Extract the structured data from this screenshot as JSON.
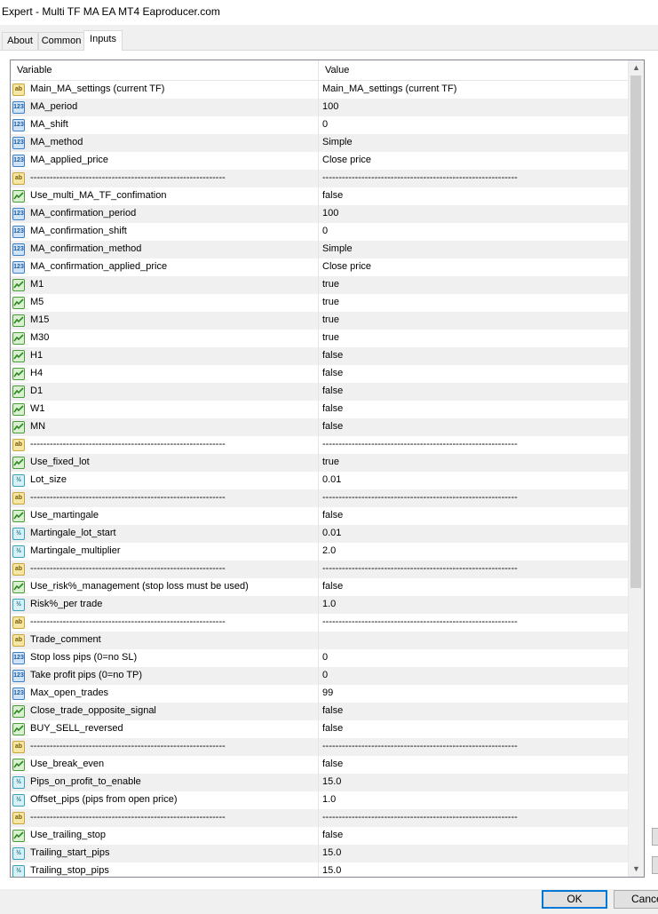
{
  "window": {
    "title": "Expert - Multi TF MA EA MT4 Eaproducer.com"
  },
  "tabs": [
    {
      "label": "About"
    },
    {
      "label": "Common"
    },
    {
      "label": "Inputs"
    }
  ],
  "grid": {
    "col_variable": "Variable",
    "col_value": "Value",
    "rows": [
      {
        "icon": "ab",
        "name": "Main_MA_settings (current TF)",
        "value": "Main_MA_settings (current TF)"
      },
      {
        "icon": "123",
        "name": "MA_period",
        "value": "100"
      },
      {
        "icon": "123",
        "name": "MA_shift",
        "value": "0"
      },
      {
        "icon": "123",
        "name": "MA_method",
        "value": "Simple"
      },
      {
        "icon": "123",
        "name": "MA_applied_price",
        "value": "Close price"
      },
      {
        "icon": "ab",
        "name": "------------------------------------------------------------",
        "value": "------------------------------------------------------------"
      },
      {
        "icon": "bool",
        "name": "Use_multi_MA_TF_confimation",
        "value": "false"
      },
      {
        "icon": "123",
        "name": "MA_confirmation_period",
        "value": "100"
      },
      {
        "icon": "123",
        "name": "MA_confirmation_shift",
        "value": "0"
      },
      {
        "icon": "123",
        "name": "MA_confirmation_method",
        "value": "Simple"
      },
      {
        "icon": "123",
        "name": "MA_confirmation_applied_price",
        "value": "Close price"
      },
      {
        "icon": "bool",
        "name": "M1",
        "value": "true"
      },
      {
        "icon": "bool",
        "name": "M5",
        "value": "true"
      },
      {
        "icon": "bool",
        "name": "M15",
        "value": "true"
      },
      {
        "icon": "bool",
        "name": "M30",
        "value": "true"
      },
      {
        "icon": "bool",
        "name": "H1",
        "value": "false"
      },
      {
        "icon": "bool",
        "name": "H4",
        "value": "false"
      },
      {
        "icon": "bool",
        "name": "D1",
        "value": "false"
      },
      {
        "icon": "bool",
        "name": "W1",
        "value": "false"
      },
      {
        "icon": "bool",
        "name": "MN",
        "value": "false"
      },
      {
        "icon": "ab",
        "name": "------------------------------------------------------------",
        "value": "------------------------------------------------------------"
      },
      {
        "icon": "bool",
        "name": "Use_fixed_lot",
        "value": "true"
      },
      {
        "icon": "dbl",
        "name": "Lot_size",
        "value": "0.01"
      },
      {
        "icon": "ab",
        "name": "------------------------------------------------------------",
        "value": "------------------------------------------------------------"
      },
      {
        "icon": "bool",
        "name": "Use_martingale",
        "value": "false"
      },
      {
        "icon": "dbl",
        "name": "Martingale_lot_start",
        "value": "0.01"
      },
      {
        "icon": "dbl",
        "name": "Martingale_multiplier",
        "value": "2.0"
      },
      {
        "icon": "ab",
        "name": "------------------------------------------------------------",
        "value": "------------------------------------------------------------"
      },
      {
        "icon": "bool",
        "name": "Use_risk%_management (stop loss must be used)",
        "value": "false"
      },
      {
        "icon": "dbl",
        "name": "Risk%_per trade",
        "value": "1.0"
      },
      {
        "icon": "ab",
        "name": "------------------------------------------------------------",
        "value": "------------------------------------------------------------"
      },
      {
        "icon": "ab",
        "name": "Trade_comment",
        "value": ""
      },
      {
        "icon": "123",
        "name": "Stop loss pips (0=no SL)",
        "value": "0"
      },
      {
        "icon": "123",
        "name": "Take profit pips (0=no TP)",
        "value": "0"
      },
      {
        "icon": "123",
        "name": "Max_open_trades",
        "value": "99"
      },
      {
        "icon": "bool",
        "name": "Close_trade_opposite_signal",
        "value": "false"
      },
      {
        "icon": "bool",
        "name": "BUY_SELL_reversed",
        "value": "false"
      },
      {
        "icon": "ab",
        "name": "------------------------------------------------------------",
        "value": "------------------------------------------------------------"
      },
      {
        "icon": "bool",
        "name": "Use_break_even",
        "value": "false"
      },
      {
        "icon": "dbl",
        "name": "Pips_on_profit_to_enable",
        "value": "15.0"
      },
      {
        "icon": "dbl",
        "name": "Offset_pips (pips from open price)",
        "value": "1.0"
      },
      {
        "icon": "ab",
        "name": "------------------------------------------------------------",
        "value": "------------------------------------------------------------"
      },
      {
        "icon": "bool",
        "name": "Use_trailing_stop",
        "value": "false"
      },
      {
        "icon": "dbl",
        "name": "Trailing_start_pips",
        "value": "15.0"
      },
      {
        "icon": "dbl",
        "name": "Trailing_stop_pips",
        "value": "15.0"
      }
    ]
  },
  "icon_labels": {
    "ab": "ab",
    "123": "123",
    "dbl": "½"
  },
  "buttons": {
    "ok": "OK",
    "cancel": "Cance"
  }
}
